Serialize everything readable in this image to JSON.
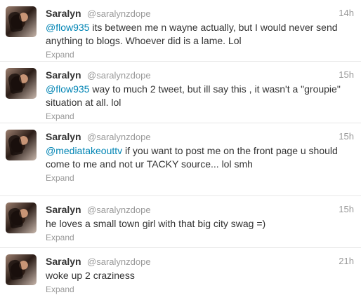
{
  "tweets": [
    {
      "name": "Saralyn",
      "handle": "@saralynzdope",
      "time": "14h",
      "mention": "@flow935",
      "text": " its between me n wayne actually, but I would never send anything to blogs. Whoever did is a lame. Lol",
      "expand": "Expand"
    },
    {
      "name": "Saralyn",
      "handle": "@saralynzdope",
      "time": "15h",
      "mention": "@flow935",
      "text": " way to much 2 tweet, but ill say this , it wasn't a \"groupie\" situation at all. lol",
      "expand": "Expand"
    },
    {
      "name": "Saralyn",
      "handle": "@saralynzdope",
      "time": "15h",
      "mention": "@mediatakeouttv",
      "text": " if you want to post me on the front page u should come to me and not ur TACKY source... lol smh",
      "expand": "Expand"
    },
    {
      "name": "Saralyn",
      "handle": "@saralynzdope",
      "time": "15h",
      "mention": "",
      "text": "he loves a small town girl with that big city swag =)",
      "expand": "Expand"
    },
    {
      "name": "Saralyn",
      "handle": "@saralynzdope",
      "time": "21h",
      "mention": "",
      "text": "woke up 2 craziness",
      "expand": "Expand"
    }
  ],
  "colors": {
    "link": "#0084b4",
    "text": "#333333",
    "muted": "#999999",
    "divider": "#e8e8e8"
  },
  "icons": {
    "avatar": "profile-photo"
  }
}
